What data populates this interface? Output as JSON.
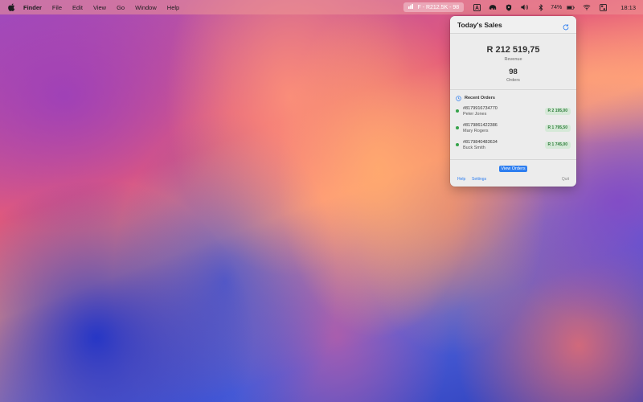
{
  "menubar": {
    "items": [
      "Finder",
      "File",
      "Edit",
      "View",
      "Go",
      "Window",
      "Help"
    ],
    "status_item": "F - R212.5K - 98",
    "battery_percent": "74%",
    "time": "18:13"
  },
  "popover": {
    "title": "Today's Sales",
    "revenue": "R 212 519,75",
    "revenue_label": "Revenue",
    "orders": "98",
    "orders_label": "Orders",
    "recent_title": "Recent Orders",
    "recent_orders": [
      {
        "number": "#8179916734770",
        "name": "Peter Jones",
        "amount": "R 2 195,00"
      },
      {
        "number": "#8179861422386",
        "name": "Mary Rogers",
        "amount": "R 1 795,50"
      },
      {
        "number": "#8179840483634",
        "name": "Buck Smith",
        "amount": "R 1 745,00"
      }
    ],
    "view_orders_label": "View Orders",
    "help_label": "Help",
    "settings_label": "Settings",
    "quit_label": "Quit"
  },
  "icons": {
    "apple": "apple-icon",
    "status_chart": "bar-chart-icon",
    "refresh": "refresh-icon",
    "recent": "clock-icon"
  },
  "colors": {
    "accent": "#2d7ef0",
    "amount_bg": "#d6e9d8",
    "amount_text": "#2e7d3a"
  }
}
